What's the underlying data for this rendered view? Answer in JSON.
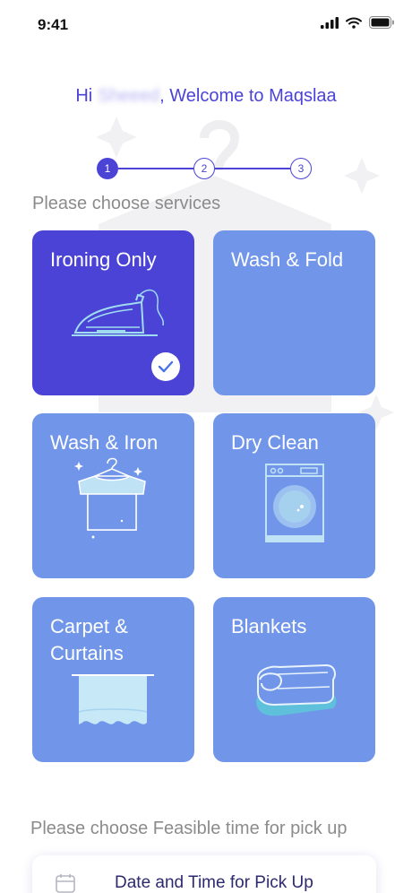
{
  "status_bar": {
    "time": "9:41"
  },
  "header": {
    "greeting_prefix": "Hi",
    "user_name": "Sheeed",
    "greeting_suffix": ", Welcome to Maqslaa"
  },
  "stepper": {
    "steps": [
      "1",
      "2",
      "3"
    ],
    "active_step": "1"
  },
  "services": {
    "title": "Please choose services",
    "items": [
      {
        "label": "Ironing Only",
        "icon": "iron-icon",
        "selected": true
      },
      {
        "label": "Wash & Fold",
        "icon": "none",
        "selected": false
      },
      {
        "label": "Wash & Iron",
        "icon": "shirt-hanger-icon",
        "selected": false
      },
      {
        "label": "Dry Clean",
        "icon": "washing-machine-icon",
        "selected": false
      },
      {
        "label": "Carpet &",
        "label2": "Curtains",
        "icon": "curtain-icon",
        "selected": false
      },
      {
        "label": "Blankets",
        "icon": "blanket-icon",
        "selected": false
      }
    ]
  },
  "pickup": {
    "title": "Please choose Feasible time for pick up",
    "field_label": "Date and Time for Pick Up",
    "icon": "calendar-icon"
  },
  "colors": {
    "primary": "#4b43d6",
    "card": "#7196e9",
    "muted_text": "#8b8b8b"
  }
}
